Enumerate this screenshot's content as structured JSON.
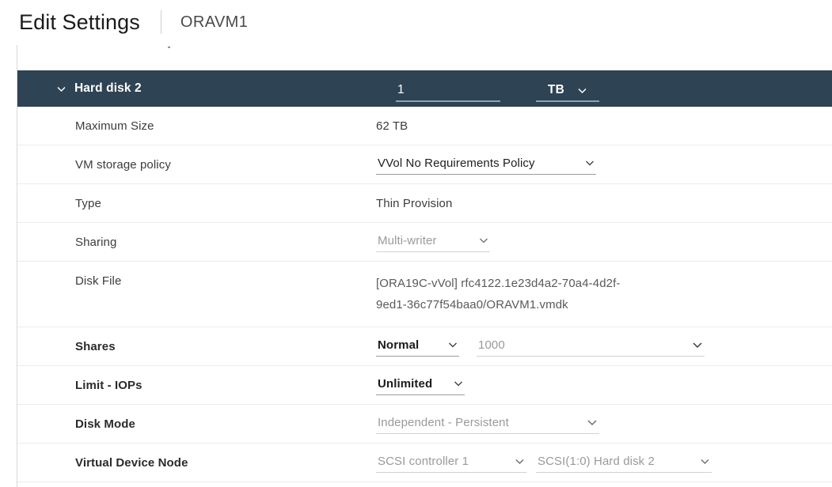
{
  "header": {
    "title": "Edit Settings",
    "vm_name": "ORAVM1"
  },
  "section": {
    "caret_icon": "chevron-down-icon",
    "title": "Hard disk 2",
    "size_value": "1",
    "size_unit": "TB",
    "unit_caret_icon": "chevron-down-icon"
  },
  "rows": [
    {
      "label": "Maximum Size",
      "value": "62 TB",
      "kind": "text"
    },
    {
      "label": "VM storage policy",
      "value": "VVol No Requirements Policy",
      "kind": "select",
      "state": "enabled"
    },
    {
      "label": "Type",
      "value": "Thin Provision",
      "kind": "text"
    },
    {
      "label": "Sharing",
      "value": "Multi-writer",
      "kind": "select",
      "state": "disabled"
    },
    {
      "label": "Disk File",
      "value_line1": "[ORA19C-vVol] rfc4122.1e23d4a2-70a4-4d2f-",
      "value_line2": "9ed1-36c77f54baa0/ORAVM1.vmdk",
      "kind": "multiline"
    },
    {
      "label": "Shares",
      "value": "Normal",
      "value2": "1000",
      "kind": "select-pair"
    },
    {
      "label": "Limit - IOPs",
      "value": "Unlimited",
      "kind": "select",
      "state": "enabled"
    },
    {
      "label": "Disk Mode",
      "value": "Independent - Persistent",
      "kind": "select",
      "state": "disabled"
    },
    {
      "label": "Virtual Device Node",
      "value": "SCSI controller 1",
      "value2": "SCSI(1:0) Hard disk 2",
      "kind": "select-pair-disabled"
    }
  ],
  "colors": {
    "section_header_bg": "#2e4354",
    "text_primary": "#3c3c3c",
    "text_disabled": "#9a9a9a",
    "row_divider": "#ececec"
  }
}
